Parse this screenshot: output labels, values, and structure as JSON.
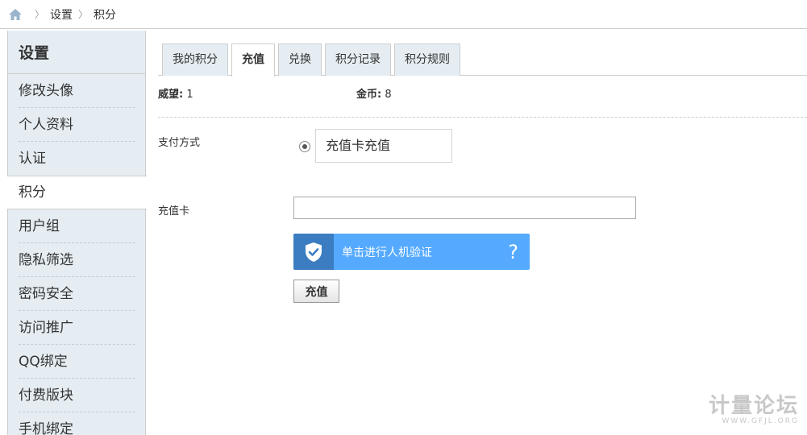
{
  "breadcrumb": {
    "items": [
      "设置",
      "积分"
    ]
  },
  "sidebar": {
    "title": "设置",
    "items": [
      {
        "label": "修改头像"
      },
      {
        "label": "个人资料"
      },
      {
        "label": "认证"
      },
      {
        "label": "积分",
        "active": true
      },
      {
        "label": "用户组"
      },
      {
        "label": "隐私筛选"
      },
      {
        "label": "密码安全"
      },
      {
        "label": "访问推广"
      },
      {
        "label": "QQ绑定"
      },
      {
        "label": "付费版块"
      },
      {
        "label": "手机绑定"
      }
    ]
  },
  "tabs": [
    {
      "label": "我的积分"
    },
    {
      "label": "充值",
      "active": true
    },
    {
      "label": "兑换"
    },
    {
      "label": "积分记录"
    },
    {
      "label": "积分规则"
    }
  ],
  "stats": {
    "prestige_label": "威望:",
    "prestige_value": "1",
    "gold_label": "金币:",
    "gold_value": "8"
  },
  "form": {
    "payment_label": "支付方式",
    "payment_option": "充值卡充值",
    "card_label": "充值卡",
    "card_value": "",
    "captcha_text": "单击进行人机验证",
    "captcha_help": "?",
    "submit_label": "充值"
  },
  "watermark": {
    "main": "计量论坛",
    "sub": "WWW.GFJL.ORG"
  },
  "colors": {
    "sidebar_bg": "#e5edf2",
    "captcha_bg": "#55aaff",
    "captcha_shield": "#3b7dc0"
  }
}
